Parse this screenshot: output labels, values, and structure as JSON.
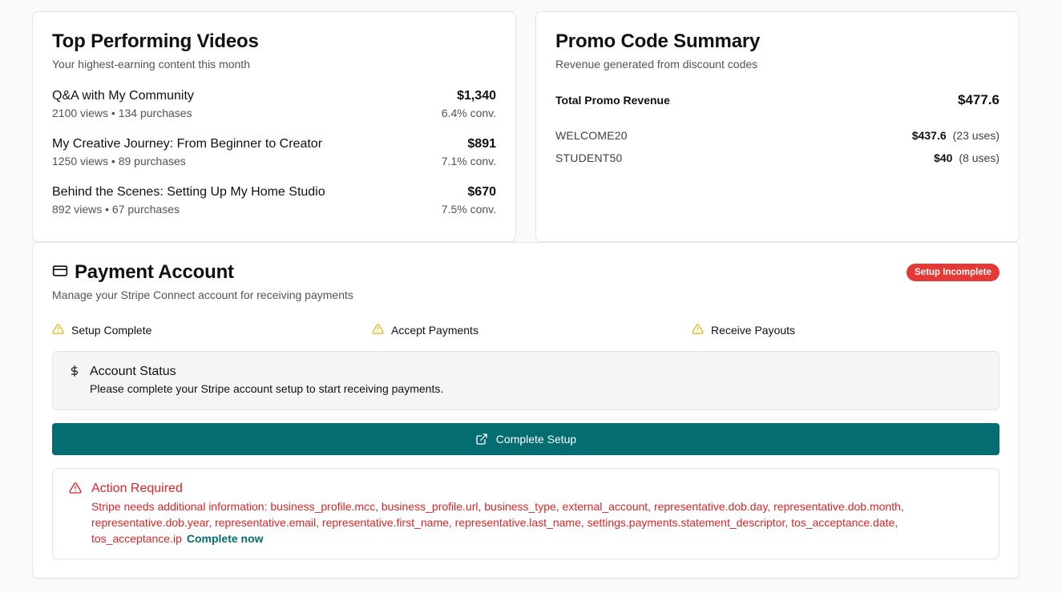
{
  "videos": {
    "title": "Top Performing Videos",
    "subtitle": "Your highest-earning content this month",
    "items": [
      {
        "title": "Q&A with My Community",
        "meta": "2100 views • 134 purchases",
        "revenue": "$1,340",
        "conv": "6.4% conv."
      },
      {
        "title": "My Creative Journey: From Beginner to Creator",
        "meta": "1250 views • 89 purchases",
        "revenue": "$891",
        "conv": "7.1% conv."
      },
      {
        "title": "Behind the Scenes: Setting Up My Home Studio",
        "meta": "892 views • 67 purchases",
        "revenue": "$670",
        "conv": "7.5% conv."
      }
    ]
  },
  "promo": {
    "title": "Promo Code Summary",
    "subtitle": "Revenue generated from discount codes",
    "total_label": "Total Promo Revenue",
    "total_value": "$477.6",
    "codes": [
      {
        "code": "WELCOME20",
        "amount": "$437.6",
        "uses": "(23 uses)"
      },
      {
        "code": "STUDENT50",
        "amount": "$40",
        "uses": "(8 uses)"
      }
    ]
  },
  "payment": {
    "title": "Payment Account",
    "subtitle": "Manage your Stripe Connect account for receiving payments",
    "badge": "Setup Incomplete",
    "statuses": [
      "Setup Complete",
      "Accept Payments",
      "Receive Payouts"
    ],
    "account_status_title": "Account Status",
    "account_status_text": "Please complete your Stripe account setup to start receiving payments.",
    "setup_button": "Complete Setup",
    "action_title": "Action Required",
    "action_text": "Stripe needs additional information: business_profile.mcc, business_profile.url, business_type, external_account, representative.dob.day, representative.dob.month, representative.dob.year, representative.email, representative.first_name, representative.last_name, settings.payments.statement_descriptor, tos_acceptance.date, tos_acceptance.ip",
    "action_link": "Complete now"
  },
  "colors": {
    "accent": "#036d72",
    "danger": "#dc2626",
    "badge": "#e53935",
    "warning": "#eab308"
  },
  "icons": {
    "payment": "credit-card-icon",
    "status": "warning-triangle-icon",
    "account": "dollar-sign-icon",
    "button": "external-link-icon",
    "action": "alert-triangle-icon"
  }
}
